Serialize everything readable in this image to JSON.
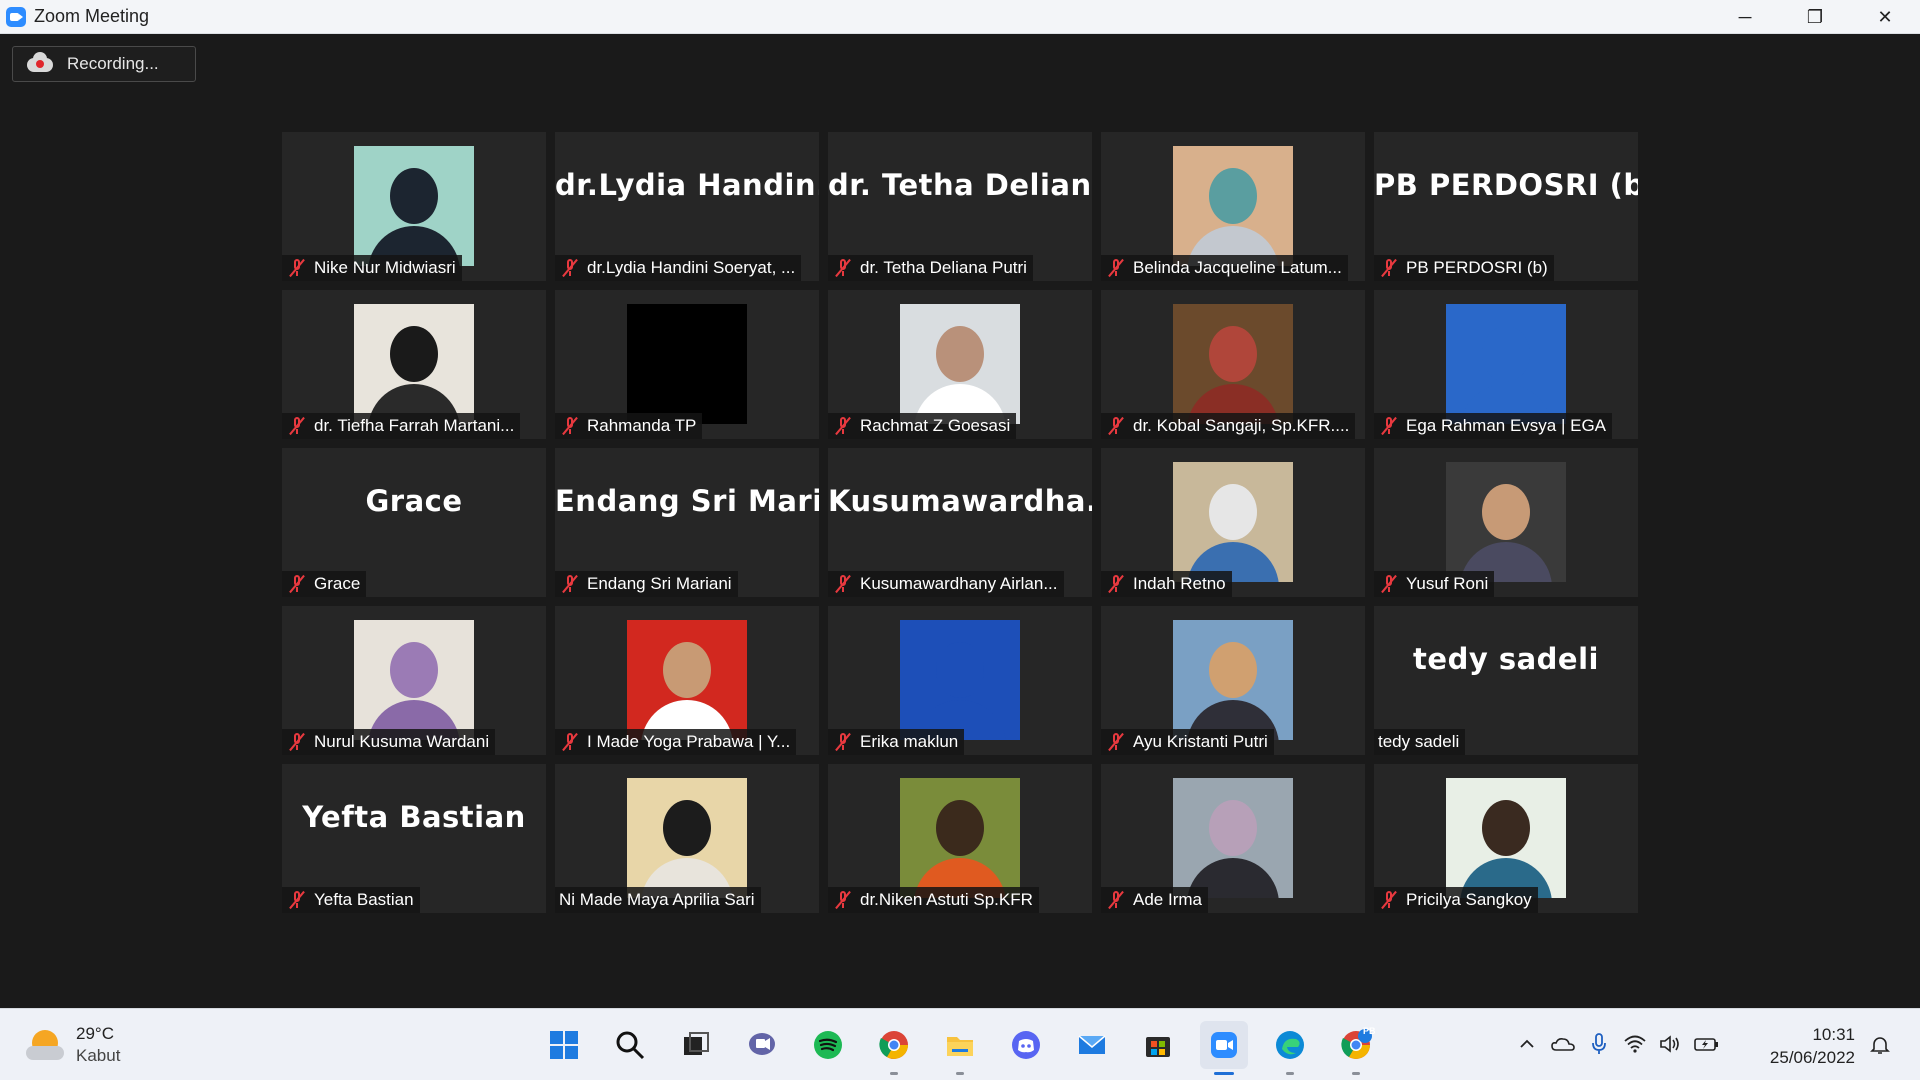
{
  "window": {
    "title": "Zoom Meeting",
    "controls": {
      "minimize": "─",
      "restore": "❐",
      "close": "✕"
    }
  },
  "recording": {
    "label": "Recording..."
  },
  "participants": [
    {
      "display": "photo",
      "name": "Nike Nur Midwiasri",
      "muted": true,
      "bg": "#9fd3c7",
      "head": "#1c2530",
      "body": "#1c2530"
    },
    {
      "display": "text",
      "big": "dr.Lydia  Handin...",
      "name": "dr.Lydia Handini Soeryat, ...",
      "muted": true
    },
    {
      "display": "text",
      "big": "dr.  Tetha  Delian...",
      "name": "dr. Tetha Deliana Putri",
      "muted": true
    },
    {
      "display": "photo",
      "name": "Belinda Jacqueline Latum...",
      "muted": true,
      "bg": "#d8b08c",
      "head": "#5a9ea0",
      "body": "#c3c8cf"
    },
    {
      "display": "text",
      "big": "PB PERDOSRI (b)",
      "name": "PB PERDOSRI (b)",
      "muted": true
    },
    {
      "display": "photo",
      "name": "dr. Tiefha Farrah Martani...",
      "muted": true,
      "bg": "#e8e4dc",
      "head": "#1a1a1a",
      "body": "#2a2a2a"
    },
    {
      "display": "photo",
      "name": "Rahmanda TP",
      "muted": true,
      "bg": "#000000",
      "head": "#000000",
      "body": "#000000"
    },
    {
      "display": "photo",
      "name": "Rachmat Z Goesasi",
      "muted": true,
      "bg": "#d9dde0",
      "head": "#b9917a",
      "body": "#ffffff"
    },
    {
      "display": "photo",
      "name": "dr. Kobal Sangaji, Sp.KFR....",
      "muted": true,
      "bg": "#6b4a2c",
      "head": "#b0463a",
      "body": "#8a2e25"
    },
    {
      "display": "photo",
      "name": "Ega Rahman Evsya | EGA",
      "muted": true,
      "bg": "#2a68c9",
      "head": "#2a68c9",
      "body": "#2a68c9"
    },
    {
      "display": "text",
      "big": "Grace",
      "name": "Grace",
      "muted": true
    },
    {
      "display": "text",
      "big": "Endang  Sri  Mari...",
      "name": "Endang Sri Mariani",
      "muted": true
    },
    {
      "display": "text",
      "big": "Kusumawardha...",
      "name": "Kusumawardhany Airlan...",
      "muted": true
    },
    {
      "display": "photo",
      "name": "Indah Retno",
      "muted": true,
      "bg": "#c8b89a",
      "head": "#e6e6e6",
      "body": "#3a6fb0"
    },
    {
      "display": "photo",
      "name": "Yusuf Roni",
      "muted": true,
      "bg": "#3a3a3a",
      "head": "#c79a76",
      "body": "#4a4a60"
    },
    {
      "display": "photo",
      "name": "Nurul Kusuma Wardani",
      "muted": true,
      "bg": "#e7e2da",
      "head": "#9b7bb5",
      "body": "#8a6aa8"
    },
    {
      "display": "photo",
      "name": "I Made Yoga Prabawa | Y...",
      "muted": true,
      "bg": "#d2281f",
      "head": "#c89a74",
      "body": "#ffffff"
    },
    {
      "display": "photo",
      "name": "Erika maklun",
      "muted": true,
      "bg": "#1d4fb8",
      "head": "#1d4fb8",
      "body": "#1d4fb8"
    },
    {
      "display": "photo",
      "name": "Ayu Kristanti Putri",
      "muted": true,
      "bg": "#7aa0c4",
      "head": "#d0a070",
      "body": "#2f2f38"
    },
    {
      "display": "text",
      "big": "tedy sadeli",
      "name": "tedy sadeli",
      "muted": false
    },
    {
      "display": "text",
      "big": "Yefta Bastian",
      "name": "Yefta Bastian",
      "muted": true
    },
    {
      "display": "photo",
      "name": "Ni Made Maya Aprilia Sari",
      "muted": false,
      "bg": "#e8d6a8",
      "head": "#1c1c1c",
      "body": "#e8e4dc"
    },
    {
      "display": "photo",
      "name": "dr.Niken Astuti Sp.KFR",
      "muted": true,
      "bg": "#7a8c3a",
      "head": "#3b2a1c",
      "body": "#e05a20"
    },
    {
      "display": "photo",
      "name": "Ade Irma",
      "muted": true,
      "bg": "#9aa6b0",
      "head": "#b7a0b8",
      "body": "#2a2a30"
    },
    {
      "display": "photo",
      "name": "Pricilya Sangkoy",
      "muted": true,
      "bg": "#e8efe6",
      "head": "#3a2a20",
      "body": "#2a6a8a"
    }
  ],
  "taskbar": {
    "weather": {
      "temp": "29°C",
      "condition": "Kabut"
    },
    "apps": [
      {
        "name": "windows-start-icon",
        "active": false
      },
      {
        "name": "search-icon",
        "active": false
      },
      {
        "name": "task-view-icon",
        "active": false
      },
      {
        "name": "teams-chat-icon",
        "active": false
      },
      {
        "name": "spotify-icon",
        "active": false
      },
      {
        "name": "chrome-icon",
        "active": false
      },
      {
        "name": "file-explorer-icon",
        "active": false
      },
      {
        "name": "discord-icon",
        "active": false
      },
      {
        "name": "mail-icon",
        "active": false
      },
      {
        "name": "microsoft-store-icon",
        "active": false
      },
      {
        "name": "zoom-icon",
        "active": true
      },
      {
        "name": "edge-icon",
        "active": false
      },
      {
        "name": "chrome-profile-icon",
        "active": false,
        "badge": "PB"
      }
    ],
    "tray": [
      "chevron-up-icon",
      "onedrive-icon",
      "microphone-icon",
      "wifi-icon",
      "volume-icon",
      "battery-icon"
    ],
    "time": "10:31",
    "date": "25/06/2022"
  }
}
